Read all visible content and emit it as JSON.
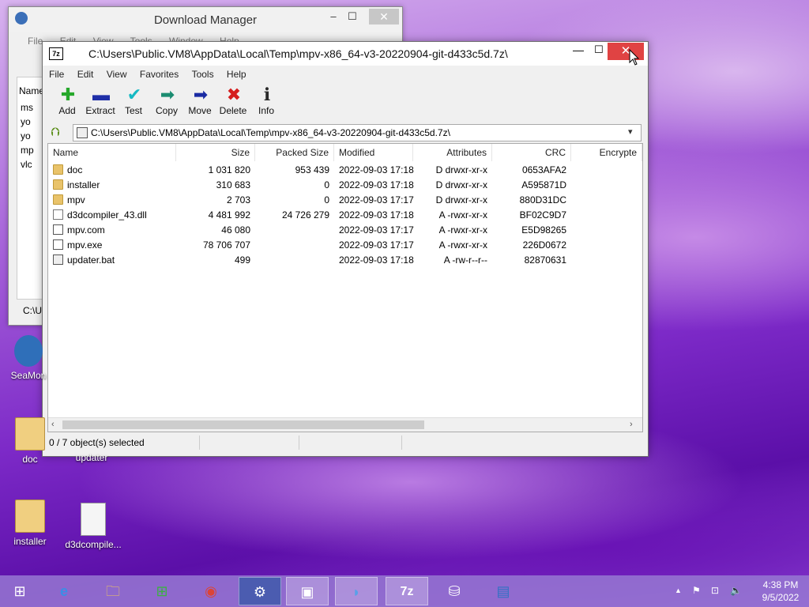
{
  "download_manager": {
    "title": "Download Manager",
    "min": "–",
    "max": "☐",
    "close": "✕",
    "menu": [
      "File",
      "Edit",
      "View",
      "Tools",
      "Window",
      "Help"
    ],
    "name_header": "Name",
    "rows": [
      "ms",
      "yo",
      "yo",
      "mp",
      "vlc"
    ],
    "status": "C:\\U"
  },
  "window": {
    "title": "C:\\Users\\Public.VM8\\AppData\\Local\\Temp\\mpv-x86_64-v3-20220904-git-d433c5d.7z\\",
    "app_icon": "7z",
    "min": "—",
    "max": "☐",
    "close": "✕"
  },
  "menubar": [
    "File",
    "Edit",
    "View",
    "Favorites",
    "Tools",
    "Help"
  ],
  "toolbar": [
    {
      "label": "Add",
      "icon": "plus-icon",
      "glyph": "✚",
      "color": "#26a82b"
    },
    {
      "label": "Extract",
      "icon": "minus-icon",
      "glyph": "▬",
      "color": "#1f2fa8"
    },
    {
      "label": "Test",
      "icon": "check-icon",
      "glyph": "✔",
      "color": "#15b9c3"
    },
    {
      "label": "Copy",
      "icon": "copy-arrow-icon",
      "glyph": "➡",
      "color": "#1b8c71"
    },
    {
      "label": "Move",
      "icon": "move-arrow-icon",
      "glyph": "➡",
      "color": "#1a2ba3"
    },
    {
      "label": "Delete",
      "icon": "delete-x-icon",
      "glyph": "✖",
      "color": "#d51e1e"
    },
    {
      "label": "Info",
      "icon": "info-icon",
      "glyph": "ℹ",
      "color": "#2a2a2a"
    }
  ],
  "address": {
    "path": "C:\\Users\\Public.VM8\\AppData\\Local\\Temp\\mpv-x86_64-v3-20220904-git-d433c5d.7z\\",
    "up_glyph": "⮉",
    "dropdown_glyph": "▾"
  },
  "columns": [
    "Name",
    "Size",
    "Packed Size",
    "Modified",
    "Attributes",
    "CRC",
    "Encrypte"
  ],
  "files": [
    {
      "name": "doc",
      "size": "1 031 820",
      "packed": "953 439",
      "modified": "2022-09-03 17:18",
      "attributes": "D drwxr-xr-x",
      "crc": "0653AFA2",
      "type": "folder"
    },
    {
      "name": "installer",
      "size": "310 683",
      "packed": "0",
      "modified": "2022-09-03 17:18",
      "attributes": "D drwxr-xr-x",
      "crc": "A595871D",
      "type": "folder"
    },
    {
      "name": "mpv",
      "size": "2 703",
      "packed": "0",
      "modified": "2022-09-03 17:17",
      "attributes": "D drwxr-xr-x",
      "crc": "880D31DC",
      "type": "folder"
    },
    {
      "name": "d3dcompiler_43.dll",
      "size": "4 481 992",
      "packed": "24 726 279",
      "modified": "2022-09-03 17:18",
      "attributes": "A -rwxr-xr-x",
      "crc": "BF02C9D7",
      "type": "dll"
    },
    {
      "name": "mpv.com",
      "size": "46 080",
      "packed": "",
      "modified": "2022-09-03 17:17",
      "attributes": "A -rwxr-xr-x",
      "crc": "E5D98265",
      "type": "exe"
    },
    {
      "name": "mpv.exe",
      "size": "78 706 707",
      "packed": "",
      "modified": "2022-09-03 17:17",
      "attributes": "A -rwxr-xr-x",
      "crc": "226D0672",
      "type": "exe"
    },
    {
      "name": "updater.bat",
      "size": "499",
      "packed": "",
      "modified": "2022-09-03 17:18",
      "attributes": "A -rw-r--r--",
      "crc": "82870631",
      "type": "bat"
    }
  ],
  "scrollbar": {
    "left": "‹",
    "right": "›"
  },
  "status": {
    "selection": "0 / 7 object(s) selected"
  },
  "desktop": [
    {
      "label": "SeaMon",
      "kind": "app"
    },
    {
      "label": "doc",
      "kind": "folder"
    },
    {
      "label": "updater",
      "kind": "blank"
    },
    {
      "label": "installer",
      "kind": "folder"
    },
    {
      "label": "d3dcompile...",
      "kind": "doc"
    }
  ],
  "taskbar": {
    "apps": [
      {
        "icon": "windows-start-icon",
        "glyph": "⊞"
      },
      {
        "icon": "internet-explorer-icon",
        "glyph": "e"
      },
      {
        "icon": "file-explorer-icon",
        "glyph": "🗀"
      },
      {
        "icon": "store-icon",
        "glyph": "⊞"
      },
      {
        "icon": "chrome-icon",
        "glyph": "◉"
      },
      {
        "icon": "settings-gear-icon",
        "glyph": "⚙"
      },
      {
        "icon": "installer-icon",
        "glyph": "▣"
      },
      {
        "icon": "seamonkey-icon",
        "glyph": "◗"
      },
      {
        "icon": "7zip-icon",
        "glyph": "7z"
      },
      {
        "icon": "database-icon",
        "glyph": "⛁"
      },
      {
        "icon": "writer-icon",
        "glyph": "▤"
      }
    ],
    "tray": {
      "time": "4:38 PM",
      "date": "9/5/2022",
      "up_arrow": "▲",
      "flag": "⚑",
      "network": "⊡",
      "volume": "🔈"
    }
  }
}
